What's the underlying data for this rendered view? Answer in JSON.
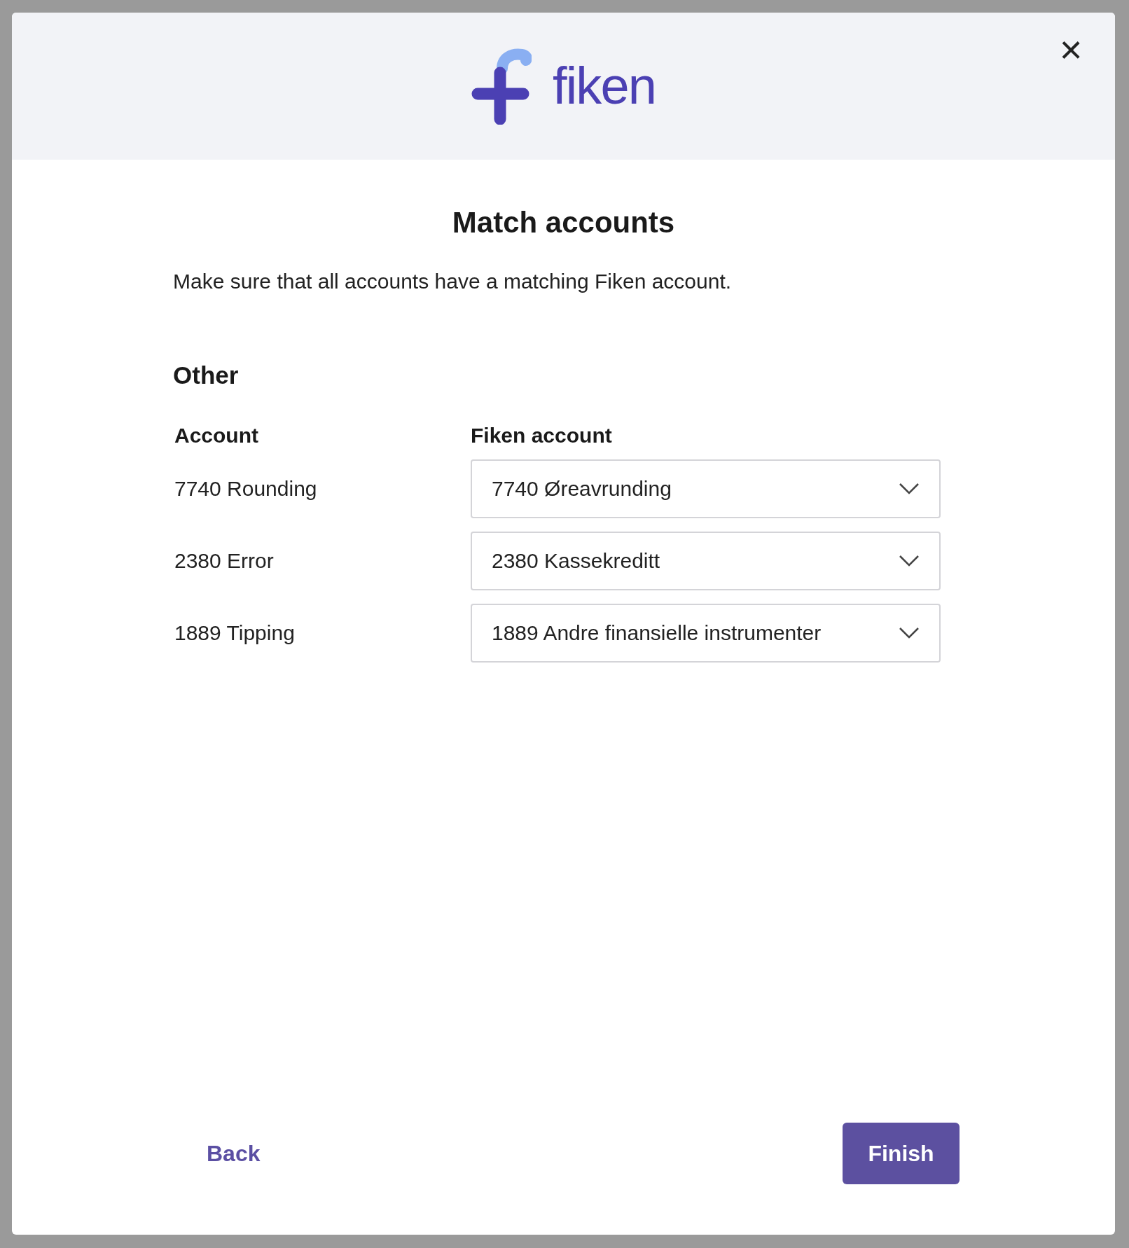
{
  "dialog": {
    "logo_text": "fiken",
    "close_label": "×",
    "title": "Match accounts",
    "description": "Make sure that all accounts have a matching Fiken account."
  },
  "section": {
    "heading": "Other",
    "columns": [
      "Account",
      "Fiken account"
    ],
    "rows": [
      {
        "account": "7740 Rounding",
        "fiken_account": "7740 Øreavrunding"
      },
      {
        "account": "2380 Error",
        "fiken_account": "2380 Kassekreditt"
      },
      {
        "account": "1889 Tipping",
        "fiken_account": "1889 Andre finansielle instrumenter"
      }
    ]
  },
  "buttons": {
    "back": "Back",
    "finish": "Finish"
  }
}
